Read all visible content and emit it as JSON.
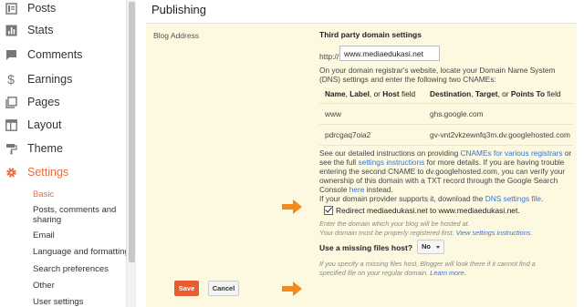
{
  "sidebar": {
    "items": [
      {
        "label": "Posts",
        "icon": "posts-icon"
      },
      {
        "label": "Stats",
        "icon": "stats-icon"
      },
      {
        "label": "Comments",
        "icon": "comment-icon"
      },
      {
        "label": "Earnings",
        "icon": "dollar-icon"
      },
      {
        "label": "Pages",
        "icon": "pages-icon"
      },
      {
        "label": "Layout",
        "icon": "layout-icon"
      },
      {
        "label": "Theme",
        "icon": "paint-roller-icon"
      },
      {
        "label": "Settings",
        "icon": "gear-icon"
      }
    ],
    "subitems": [
      "Basic",
      "Posts, comments and",
      "sharing",
      "Email",
      "Language and formatting",
      "Search preferences",
      "Other",
      "User settings"
    ]
  },
  "main": {
    "title": "Publishing",
    "row_label": "Blog Address",
    "section_title": "Third party domain settings",
    "http_prefix": "http://",
    "domain_value": "www.mediaedukasi.net",
    "instructions": [
      "On your domain registrar's website, locate your Domain Name System",
      "(DNS) settings and enter the following two CNAMEs:"
    ],
    "table": {
      "header_left": [
        "Name",
        ", ",
        "Label",
        ", or ",
        "Host",
        " field"
      ],
      "header_right": [
        "Destination",
        ", ",
        "Target",
        ", or ",
        "Points To",
        " field"
      ],
      "rows": [
        {
          "name": "www",
          "destination": "ghs.google.com"
        },
        {
          "name": "pdrcgaq7oia2",
          "destination": "gv-vnt2vkzewnfq3m.dv.googlehosted.com"
        }
      ]
    },
    "details": {
      "line1_a": "See our detailed instructions on providing ",
      "line1_link": "CNAMEs for various registrars",
      "line1_b": " or",
      "line2_a": "see the full ",
      "line2_link": "settings instructions",
      "line2_b": " for more details. If you are having trouble",
      "line3": "entering the second CNAME to dv.googlehosted.com, you can verify your",
      "line4": "ownership of this domain with a TXT record through the Google Search",
      "line5_a": "Console ",
      "line5_link": "here",
      "line5_b": " instead.",
      "line6_a": "If your domain provider supports it, download the ",
      "line6_link": "DNS settings file",
      "line6_b": "."
    },
    "redirect_label": "Redirect mediaedukasi.net to www.mediaedukasi.net.",
    "redirect_checked": true,
    "hint1": "Enter the domain which your blog will be hosted at.",
    "hint2_a": "Your domain must be properly registered first. ",
    "hint2_link": "View settings instructions.",
    "missing_files_q": "Use a missing files host?",
    "missing_files_value": "No",
    "hint3": "If you specify a missing files host, Blogger will look there if it cannot find a",
    "hint4_a": "specified file on your regular domain. ",
    "hint4_link": "Learn more.",
    "save_label": "Save",
    "cancel_label": "Cancel"
  },
  "colors": {
    "accent": "#f0693a",
    "panel_bg": "#fdf9e1",
    "link": "#3a74c8",
    "save_bg": "#e95c32"
  }
}
